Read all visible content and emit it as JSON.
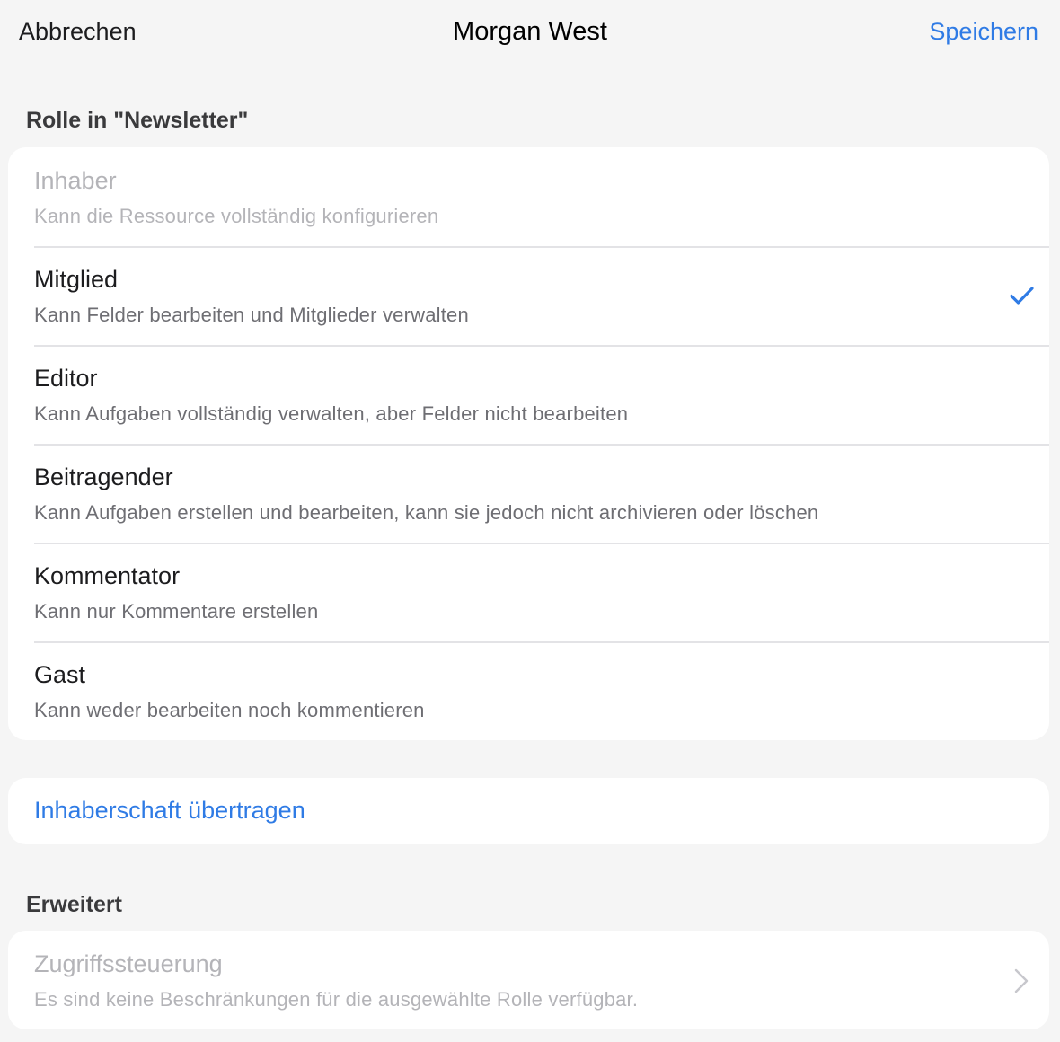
{
  "nav": {
    "cancel": "Abbrechen",
    "title": "Morgan West",
    "save": "Speichern"
  },
  "role_section": {
    "header": "Rolle in \"Newsletter\"",
    "selected_role": "Mitglied",
    "roles": [
      {
        "name": "Inhaber",
        "description": "Kann die Ressource vollständig konfigurieren",
        "enabled": false,
        "selected": false
      },
      {
        "name": "Mitglied",
        "description": "Kann Felder bearbeiten und Mitglieder verwalten",
        "enabled": true,
        "selected": true
      },
      {
        "name": "Editor",
        "description": "Kann Aufgaben vollständig verwalten, aber Felder nicht bearbeiten",
        "enabled": true,
        "selected": false
      },
      {
        "name": "Beitragender",
        "description": "Kann Aufgaben erstellen und bearbeiten, kann sie jedoch nicht archivieren oder löschen",
        "enabled": true,
        "selected": false
      },
      {
        "name": "Kommentator",
        "description": "Kann nur Kommentare erstellen",
        "enabled": true,
        "selected": false
      },
      {
        "name": "Gast",
        "description": "Kann weder bearbeiten noch kommentieren",
        "enabled": true,
        "selected": false
      }
    ]
  },
  "transfer": {
    "label": "Inhaberschaft übertragen"
  },
  "advanced": {
    "header": "Erweitert",
    "access_control": {
      "title": "Zugriffssteuerung",
      "description": "Es sind keine Beschränkungen für die ausgewählte Rolle verfügbar.",
      "enabled": false
    }
  },
  "icons": {
    "selected": "checkmark-icon",
    "disclosure": "chevron-right-icon"
  },
  "colors": {
    "accent": "#2f7be5",
    "background": "#f5f5f5",
    "card": "#ffffff",
    "disabled_text": "#b4b4b8",
    "secondary_text": "#6e6e73",
    "separator": "#e3e3e6"
  }
}
